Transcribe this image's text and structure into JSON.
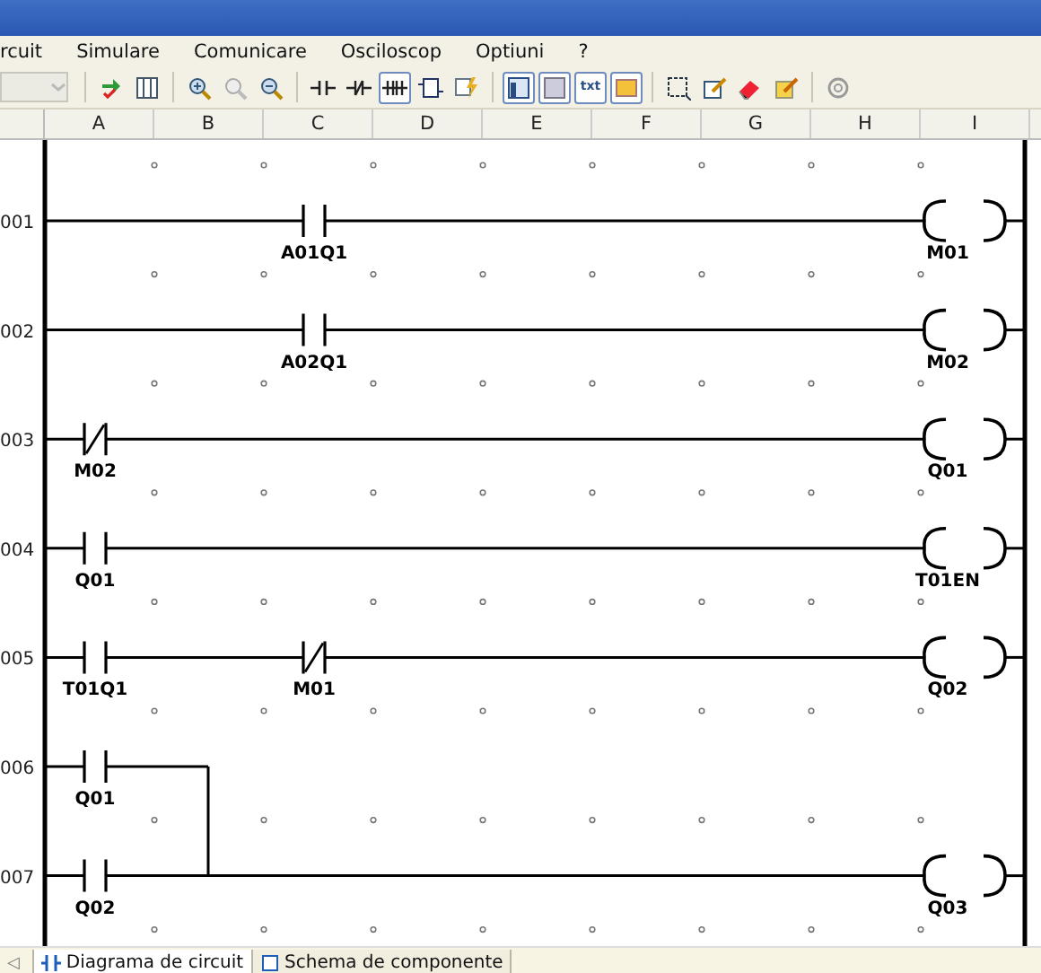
{
  "menu": [
    "rcuit",
    "Simulare",
    "Comunicare",
    "Osciloscop",
    "Optiuni",
    "?"
  ],
  "toolbar": [
    {
      "kind": "combo",
      "disabled": true
    },
    {
      "kind": "sep"
    },
    {
      "kind": "transfer",
      "pressed": false
    },
    {
      "kind": "table",
      "pressed": false
    },
    {
      "kind": "sep"
    },
    {
      "kind": "zoom-in",
      "pressed": false
    },
    {
      "kind": "zoom-fit",
      "pressed": false
    },
    {
      "kind": "zoom-out",
      "pressed": false
    },
    {
      "kind": "sep"
    },
    {
      "kind": "contact",
      "pressed": false
    },
    {
      "kind": "nc-contact",
      "pressed": false
    },
    {
      "kind": "rung",
      "pressed": true
    },
    {
      "kind": "block",
      "pressed": false
    },
    {
      "kind": "bolt",
      "pressed": false
    },
    {
      "kind": "sep"
    },
    {
      "kind": "window",
      "pressed": true
    },
    {
      "kind": "panel",
      "pressed": true
    },
    {
      "kind": "txt",
      "label": "txt",
      "pressed": true
    },
    {
      "kind": "yellow",
      "pressed": true
    },
    {
      "kind": "sep"
    },
    {
      "kind": "select",
      "pressed": false
    },
    {
      "kind": "edit",
      "pressed": false
    },
    {
      "kind": "eraser",
      "pressed": false
    },
    {
      "kind": "note",
      "pressed": false
    },
    {
      "kind": "sep"
    },
    {
      "kind": "disc",
      "pressed": false
    }
  ],
  "columns": [
    "A",
    "B",
    "C",
    "D",
    "E",
    "F",
    "G",
    "H",
    "I"
  ],
  "rungs": [
    {
      "number": "001",
      "cells": [
        {
          "kind": "wire"
        },
        {
          "kind": "wire"
        },
        {
          "kind": "no",
          "label": "A01Q1"
        },
        {
          "kind": "wire"
        },
        {
          "kind": "wire"
        },
        {
          "kind": "wire"
        },
        {
          "kind": "wire"
        },
        {
          "kind": "wire"
        }
      ],
      "coil": "M01"
    },
    {
      "number": "002",
      "cells": [
        {
          "kind": "wire"
        },
        {
          "kind": "wire"
        },
        {
          "kind": "no",
          "label": "A02Q1"
        },
        {
          "kind": "wire"
        },
        {
          "kind": "wire"
        },
        {
          "kind": "wire"
        },
        {
          "kind": "wire"
        },
        {
          "kind": "wire"
        }
      ],
      "coil": "M02"
    },
    {
      "number": "003",
      "cells": [
        {
          "kind": "nc",
          "label": "M02"
        },
        {
          "kind": "wire"
        },
        {
          "kind": "wire"
        },
        {
          "kind": "wire"
        },
        {
          "kind": "wire"
        },
        {
          "kind": "wire"
        },
        {
          "kind": "wire"
        },
        {
          "kind": "wire"
        }
      ],
      "coil": "Q01"
    },
    {
      "number": "004",
      "cells": [
        {
          "kind": "no",
          "label": "Q01"
        },
        {
          "kind": "wire"
        },
        {
          "kind": "wire"
        },
        {
          "kind": "wire"
        },
        {
          "kind": "wire"
        },
        {
          "kind": "wire"
        },
        {
          "kind": "wire"
        },
        {
          "kind": "wire"
        }
      ],
      "coil": "T01EN"
    },
    {
      "number": "005",
      "cells": [
        {
          "kind": "no",
          "label": "T01Q1"
        },
        {
          "kind": "wire"
        },
        {
          "kind": "nc",
          "label": "M01"
        },
        {
          "kind": "wire"
        },
        {
          "kind": "wire"
        },
        {
          "kind": "wire"
        },
        {
          "kind": "wire"
        },
        {
          "kind": "wire"
        }
      ],
      "coil": "Q02"
    },
    {
      "number": "006",
      "cells": [
        {
          "kind": "no",
          "label": "Q01"
        },
        {
          "kind": "branch"
        },
        {
          "kind": "empty"
        },
        {
          "kind": "empty"
        },
        {
          "kind": "empty"
        },
        {
          "kind": "empty"
        },
        {
          "kind": "empty"
        },
        {
          "kind": "empty"
        }
      ]
    },
    {
      "number": "007",
      "cells": [
        {
          "kind": "no",
          "label": "Q02"
        },
        {
          "kind": "wire"
        },
        {
          "kind": "wire"
        },
        {
          "kind": "wire"
        },
        {
          "kind": "wire"
        },
        {
          "kind": "wire"
        },
        {
          "kind": "wire"
        },
        {
          "kind": "wire"
        }
      ],
      "coil": "Q03"
    }
  ],
  "tab_nav": "◁",
  "tabs": [
    {
      "label": "Diagrama de circuit",
      "selected": true
    },
    {
      "label": "Schema de componente",
      "selected": false
    }
  ]
}
